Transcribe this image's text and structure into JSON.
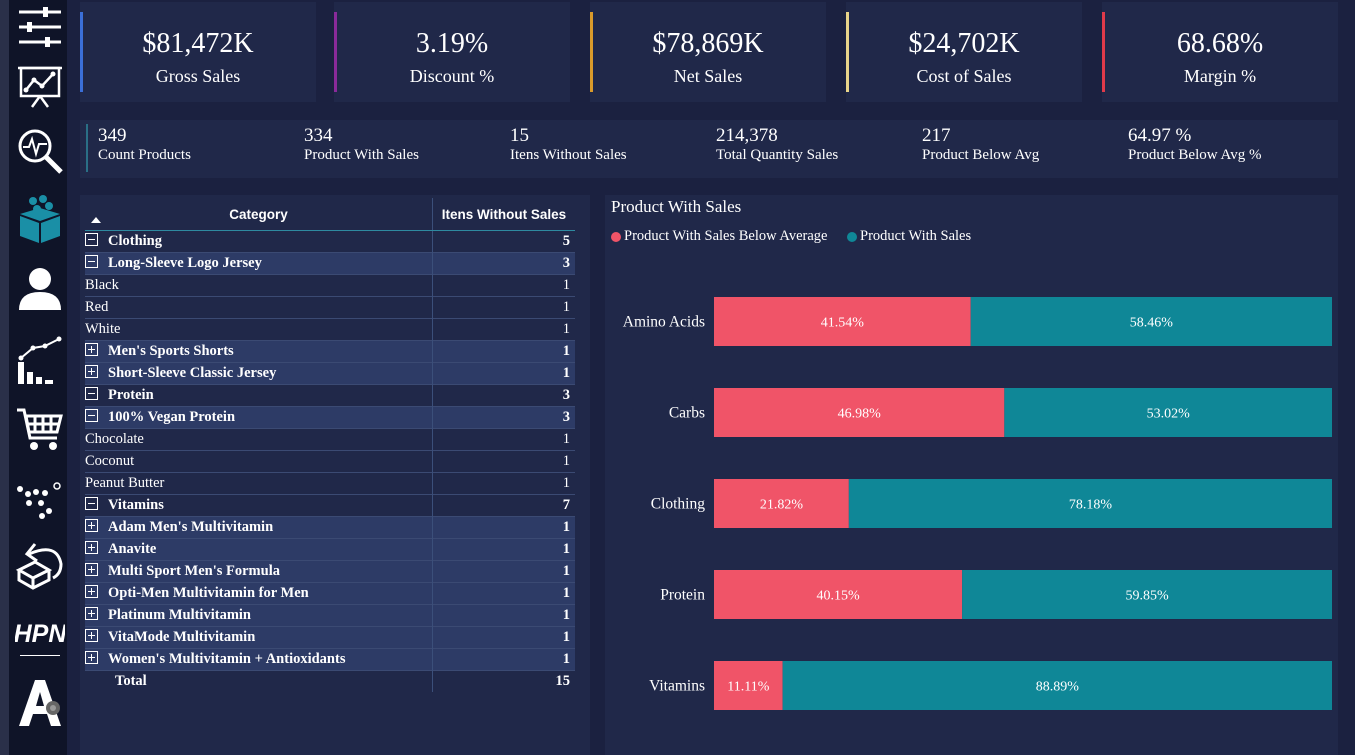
{
  "kpis": [
    {
      "value": "$81,472K",
      "label": "Gross Sales",
      "color": "#3b6fd8"
    },
    {
      "value": "3.19%",
      "label": "Discount %",
      "color": "#8a2a9a"
    },
    {
      "value": "$78,869K",
      "label": "Net Sales",
      "color": "#d99a2b"
    },
    {
      "value": "$24,702K",
      "label": "Cost of Sales",
      "color": "#e8d48a"
    },
    {
      "value": "68.68%",
      "label": "Margin %",
      "color": "#e03a4a"
    }
  ],
  "stats": [
    {
      "value": "349",
      "label": "Count Products"
    },
    {
      "value": "334",
      "label": "Product With Sales"
    },
    {
      "value": "15",
      "label": "Itens Without Sales"
    },
    {
      "value": "214,378",
      "label": "Total Quantity Sales"
    },
    {
      "value": "217",
      "label": "Product Below Avg"
    },
    {
      "value": "64.97 %",
      "label": "Product Below Avg %"
    }
  ],
  "table": {
    "headers": [
      "Category",
      "Itens Without Sales"
    ],
    "rows": [
      {
        "level": 0,
        "toggle": "minus",
        "label": "Clothing",
        "value": "5"
      },
      {
        "level": 1,
        "toggle": "minus",
        "label": "Long-Sleeve Logo Jersey",
        "value": "3"
      },
      {
        "level": 2,
        "label": "Black",
        "value": "1"
      },
      {
        "level": 2,
        "label": "Red",
        "value": "1"
      },
      {
        "level": 2,
        "label": "White",
        "value": "1"
      },
      {
        "level": 1,
        "toggle": "plus",
        "label": "Men's Sports Shorts",
        "value": "1"
      },
      {
        "level": 1,
        "toggle": "plus",
        "label": "Short-Sleeve Classic Jersey",
        "value": "1"
      },
      {
        "level": 0,
        "toggle": "minus",
        "label": "Protein",
        "value": "3"
      },
      {
        "level": 1,
        "toggle": "minus",
        "label": "100% Vegan Protein",
        "value": "3"
      },
      {
        "level": 2,
        "label": "Chocolate",
        "value": "1"
      },
      {
        "level": 2,
        "label": "Coconut",
        "value": "1"
      },
      {
        "level": 2,
        "label": "Peanut Butter",
        "value": "1"
      },
      {
        "level": 0,
        "toggle": "minus",
        "label": "Vitamins",
        "value": "7"
      },
      {
        "level": 1,
        "toggle": "plus",
        "label": "Adam Men's Multivitamin",
        "value": "1"
      },
      {
        "level": 1,
        "toggle": "plus",
        "label": "Anavite",
        "value": "1"
      },
      {
        "level": 1,
        "toggle": "plus",
        "label": "Multi Sport Men's Formula",
        "value": "1"
      },
      {
        "level": 1,
        "toggle": "plus",
        "label": "Opti-Men Multivitamin for Men",
        "value": "1"
      },
      {
        "level": 1,
        "toggle": "plus",
        "label": "Platinum Multivitamin",
        "value": "1"
      },
      {
        "level": 1,
        "toggle": "plus",
        "label": "VitaMode Multivitamin",
        "value": "1"
      },
      {
        "level": 1,
        "toggle": "plus",
        "label": "Women's Multivitamin + Antioxidants",
        "value": "1"
      }
    ],
    "total": {
      "label": "Total",
      "value": "15"
    }
  },
  "chart_data": {
    "type": "bar",
    "orientation": "horizontal",
    "stacked": "100%",
    "title": "Product With Sales",
    "categories": [
      "Amino Acids",
      "Carbs",
      "Clothing",
      "Protein",
      "Vitamins"
    ],
    "series": [
      {
        "name": "Product With Sales Below Average",
        "color": "#f05468",
        "values": [
          41.54,
          46.98,
          21.82,
          40.15,
          11.11
        ],
        "labels": [
          "41.54%",
          "46.98%",
          "21.82%",
          "40.15%",
          "11.11%"
        ]
      },
      {
        "name": "Product With Sales",
        "color": "#0f8797",
        "values": [
          58.46,
          53.02,
          78.18,
          59.85,
          88.89
        ],
        "labels": [
          "58.46%",
          "53.02%",
          "78.18%",
          "59.85%",
          "88.89%"
        ]
      }
    ],
    "xlim": [
      0,
      100
    ],
    "legend": "top-left",
    "grid": false
  },
  "nav": {
    "icons": [
      "sliders-icon",
      "presentation-chart-icon",
      "magnifier-pulse-icon",
      "box-icon",
      "user-icon",
      "growth-chart-icon",
      "cart-icon",
      "scatter-dots-icon",
      "return-box-icon",
      "logo-hpn",
      "logo-a"
    ],
    "logo_text": "HPN"
  }
}
